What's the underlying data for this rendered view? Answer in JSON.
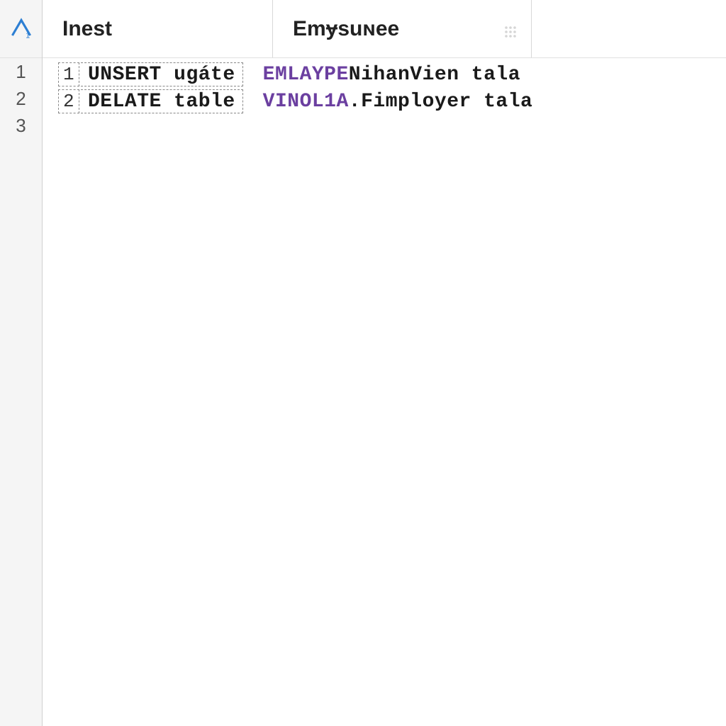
{
  "gutter": {
    "lines": [
      "1",
      "2",
      "3"
    ]
  },
  "header": {
    "cell1": "Inest",
    "cell2": "Emɏsuɴee"
  },
  "code": {
    "rows": [
      {
        "inner_num": "1",
        "stmt_kw": "UNSERT",
        "stmt_rest": "ugáte",
        "right_kw": "EMLAYPE",
        "right_text": " NihanVien tala"
      },
      {
        "inner_num": "2",
        "stmt_kw": "DELATE",
        "stmt_rest": "table",
        "right_kw": "VINOL1A",
        "right_sep": ".",
        "right_text": "Fimployer tala"
      }
    ]
  },
  "colors": {
    "keyword": "#6b3fa0",
    "text": "#1a1a1a",
    "gutter_bg": "#f5f5f5"
  }
}
